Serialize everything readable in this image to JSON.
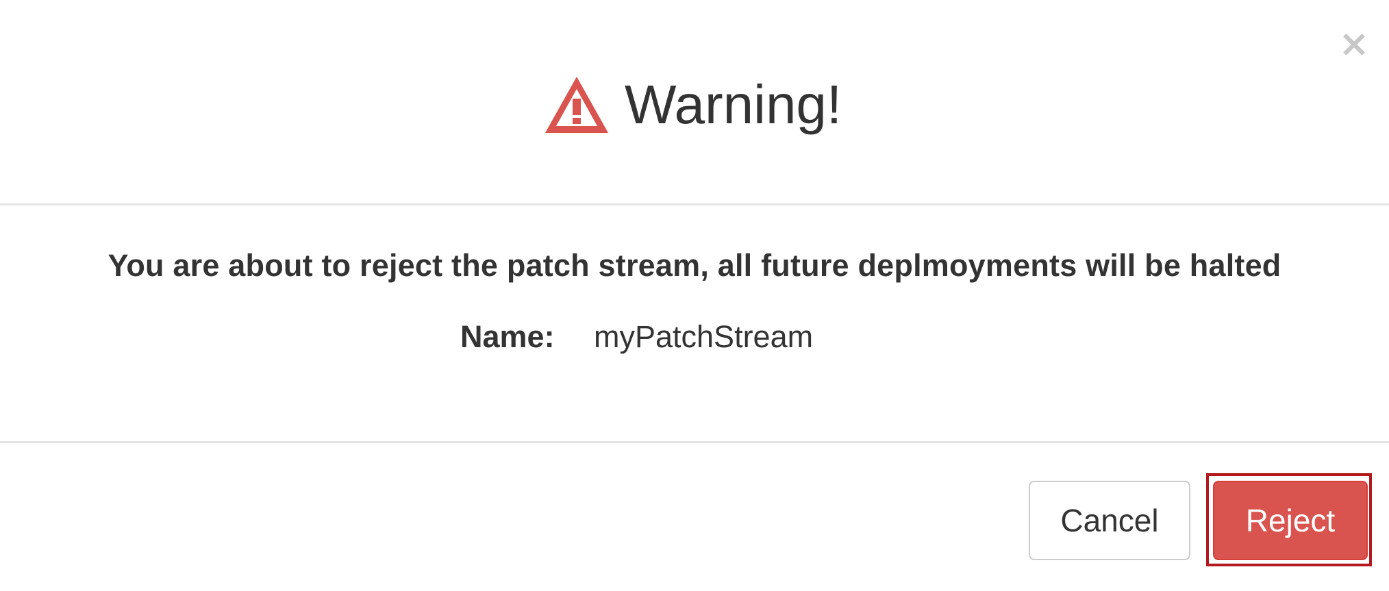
{
  "dialog": {
    "title": "Warning!",
    "close_glyph": "×",
    "icon": "warning-triangle-icon",
    "message": "You are about to reject the patch stream, all future deplmoyments will be halted",
    "name_label": "Name:",
    "name_value": "myPatchStream"
  },
  "buttons": {
    "cancel_label": "Cancel",
    "reject_label": "Reject"
  },
  "colors": {
    "danger": "#d9534f",
    "highlight_outline": "#b3181d",
    "divider": "#e5e5e5",
    "text": "#333333"
  }
}
